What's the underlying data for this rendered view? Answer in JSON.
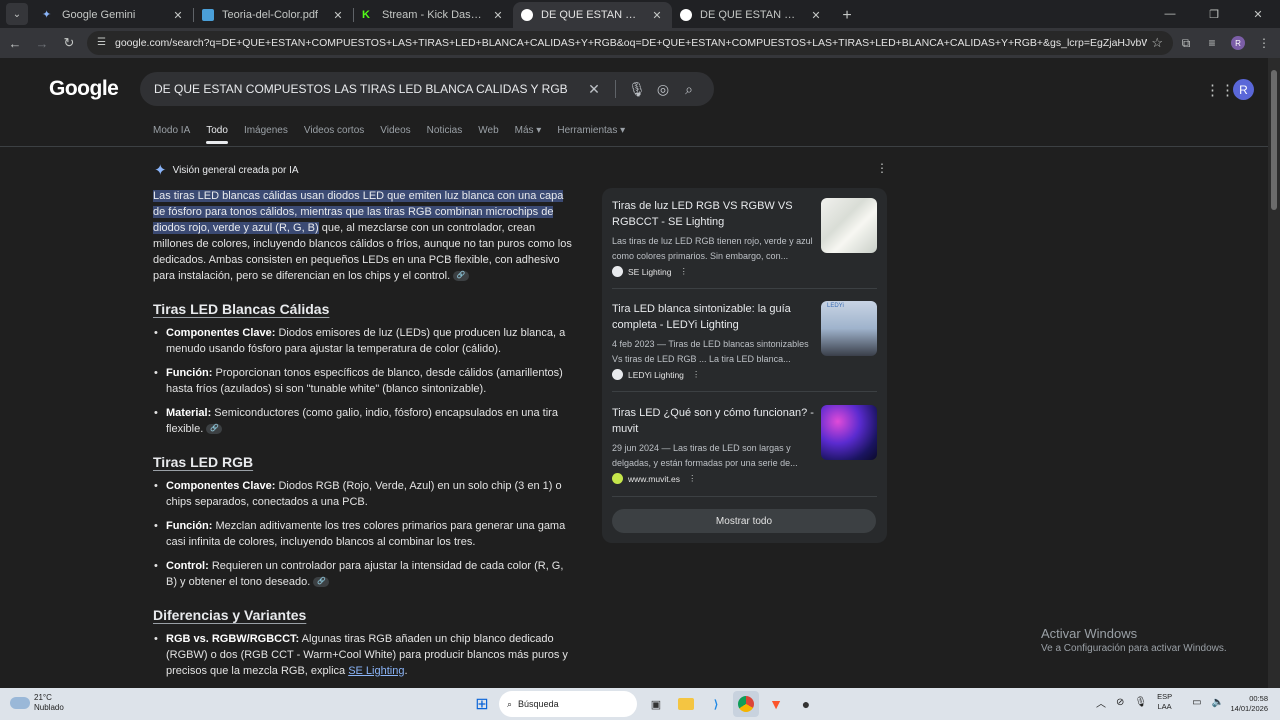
{
  "browser": {
    "tabs": [
      {
        "title": "Google Gemini",
        "color": "#8ab4f8"
      },
      {
        "title": "Teoria-del-Color.pdf",
        "color": "#4a9fd8"
      },
      {
        "title": "Stream - Kick Dashboard",
        "color": "#53fc18"
      },
      {
        "title": "DE QUE ESTAN COMPUESTOS LAS TIRAS LED BLANCA CALIDAS Y RGB",
        "color": "#ffffff"
      },
      {
        "title": "DE QUE ESTAN COMPUESTOS LAS TIRAS LED BLANCA CALIDAS Y RGB",
        "color": "#ffffff"
      }
    ],
    "active_tab_index": 3,
    "url": "google.com/search?q=DE+QUE+ESTAN+COMPUESTOS+LAS+TIRAS+LED+BLANCA+CALIDAS+Y+RGB&oq=DE+QUE+ESTAN+COMPUESTOS+LAS+TIRAS+LED+BLANCA+CALIDAS+Y+RGB+&gs_lcrp=EgZjaHJvbWUyBggAEEUYOTIKCAEQABiABBiiBDI...",
    "profile_initial": "R"
  },
  "google": {
    "logo": "Google",
    "query": "DE QUE ESTAN COMPUESTOS LAS TIRAS LED BLANCA CALIDAS Y RGB",
    "avatar_initial": "R",
    "nav": [
      "Modo IA",
      "Todo",
      "Imágenes",
      "Videos cortos",
      "Videos",
      "Noticias",
      "Web",
      "Más ▾",
      "Herramientas ▾"
    ],
    "nav_active": "Todo"
  },
  "ai_overview": {
    "header": "Visión general creada por IA",
    "intro_highlight": "Las tiras LED blancas cálidas usan diodos LED que emiten luz blanca con una capa de fósforo para tonos cálidos, mientras que las tiras RGB combinan microchips de diodos rojo, verde y azul (R, G, B)",
    "intro_rest": " que, al mezclarse con un controlador, crean millones de colores, incluyendo blancos cálidos o fríos, aunque no tan puros como los dedicados. Ambas consisten en pequeños LEDs en una PCB flexible, con adhesivo para instalación, pero se diferencian en los chips y el control.",
    "sections": [
      {
        "heading": "Tiras LED Blancas Cálidas",
        "items": [
          {
            "label": "Componentes Clave:",
            "text": " Diodos emisores de luz (LEDs) que producen luz blanca, a menudo usando fósforo para ajustar la temperatura de color (cálido)."
          },
          {
            "label": "Función:",
            "text": " Proporcionan tonos específicos de blanco, desde cálidos (amarillentos) hasta fríos (azulados) si son \"tunable white\" (blanco sintonizable)."
          },
          {
            "label": "Material:",
            "text": " Semiconductores (como galio, indio, fósforo) encapsulados en una tira flexible."
          }
        ]
      },
      {
        "heading": "Tiras LED RGB",
        "items": [
          {
            "label": "Componentes Clave:",
            "text": " Diodos RGB (Rojo, Verde, Azul) en un solo chip (3 en 1) o chips separados, conectados a una PCB."
          },
          {
            "label": "Función:",
            "text": " Mezclan aditivamente los tres colores primarios para generar una gama casi infinita de colores, incluyendo blancos al combinar los tres."
          },
          {
            "label": "Control:",
            "text": " Requieren un controlador para ajustar la intensidad de cada color (R, G, B) y obtener el tono deseado."
          }
        ]
      },
      {
        "heading": "Diferencias y Variantes",
        "items": [
          {
            "label": "RGB vs. RGBW/RGBCCT:",
            "text": " Algunas tiras RGB añaden un chip blanco dedicado (RGBW) o dos (RGB CCT - Warm+Cool White) para producir blancos más puros y precisos que la mezcla RGB, explica ",
            "link": "SE Lighting",
            "after": "."
          }
        ]
      }
    ]
  },
  "sources": [
    {
      "title": "Tiras de luz LED RGB VS RGBW VS RGBCCT - SE Lighting",
      "desc": "Las tiras de luz LED RGB tienen rojo, verde y azul como colores primarios. Sin embargo, con...",
      "site": "SE Lighting",
      "fav_color": "#e8eaed",
      "thumb": "led-strip"
    },
    {
      "title": "Tira LED blanca sintonizable: la guía completa - LEDYi Lighting",
      "desc": "4 feb 2023 — Tiras de LED blancas sintonizables Vs tiras de LED RGB ... La tira LED blanca...",
      "site": "LEDYi Lighting",
      "fav_color": "#e8eaed",
      "thumb": "person",
      "thumb_text": "LEDYi"
    },
    {
      "title": "Tiras LED ¿Qué son y cómo funcionan? - muvit",
      "desc": "29 jun 2024 — Las tiras de LED son largas y delgadas, y están formadas por una serie de...",
      "site": "www.muvit.es",
      "fav_color": "#c5e64b",
      "thumb": "party"
    }
  ],
  "show_all": "Mostrar todo",
  "watermark": {
    "title": "Activar Windows",
    "subtitle": "Ve a Configuración para activar Windows."
  },
  "taskbar": {
    "weather_temp": "21°C",
    "weather_desc": "Nublado",
    "search_placeholder": "Búsqueda",
    "lang_top": "ESP",
    "lang_bottom": "LAA",
    "time": "00:58",
    "date": "14/01/2026"
  }
}
